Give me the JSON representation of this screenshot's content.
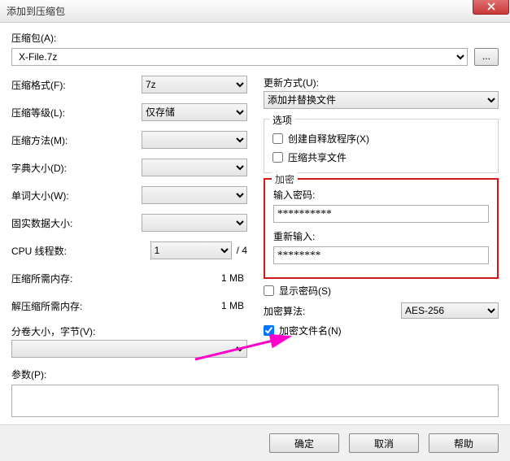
{
  "title": "添加到压缩包",
  "archive": {
    "label": "压缩包(A):",
    "value": "X-File.7z",
    "browse": "..."
  },
  "left": {
    "format": {
      "label": "压缩格式(F):",
      "value": "7z"
    },
    "level": {
      "label": "压缩等级(L):",
      "value": "仅存储"
    },
    "method": {
      "label": "压缩方法(M):",
      "value": ""
    },
    "dict": {
      "label": "字典大小(D):",
      "value": ""
    },
    "word": {
      "label": "单词大小(W):",
      "value": ""
    },
    "solid": {
      "label": "固实数据大小:",
      "value": ""
    },
    "cpu": {
      "label": "CPU 线程数:",
      "value": "1",
      "total": "/ 4"
    },
    "mem_comp": {
      "label": "压缩所需内存:",
      "value": "1 MB"
    },
    "mem_decomp": {
      "label": "解压缩所需内存:",
      "value": "1 MB"
    },
    "split": {
      "label": "分卷大小，字节(V):"
    },
    "params": {
      "label": "参数(P):"
    }
  },
  "right": {
    "update": {
      "label": "更新方式(U):",
      "value": "添加并替换文件"
    },
    "options": {
      "legend": "选项",
      "sfx": "创建自释放程序(X)",
      "shared": "压缩共享文件"
    },
    "enc": {
      "legend": "加密",
      "pw1_label": "输入密码:",
      "pw1_value": "**********",
      "pw2_label": "重新输入:",
      "pw2_value": "********"
    },
    "showpw": "显示密码(S)",
    "algo": {
      "label": "加密算法:",
      "value": "AES-256"
    },
    "encnames": "加密文件名(N)"
  },
  "buttons": {
    "ok": "确定",
    "cancel": "取消",
    "help": "帮助"
  }
}
